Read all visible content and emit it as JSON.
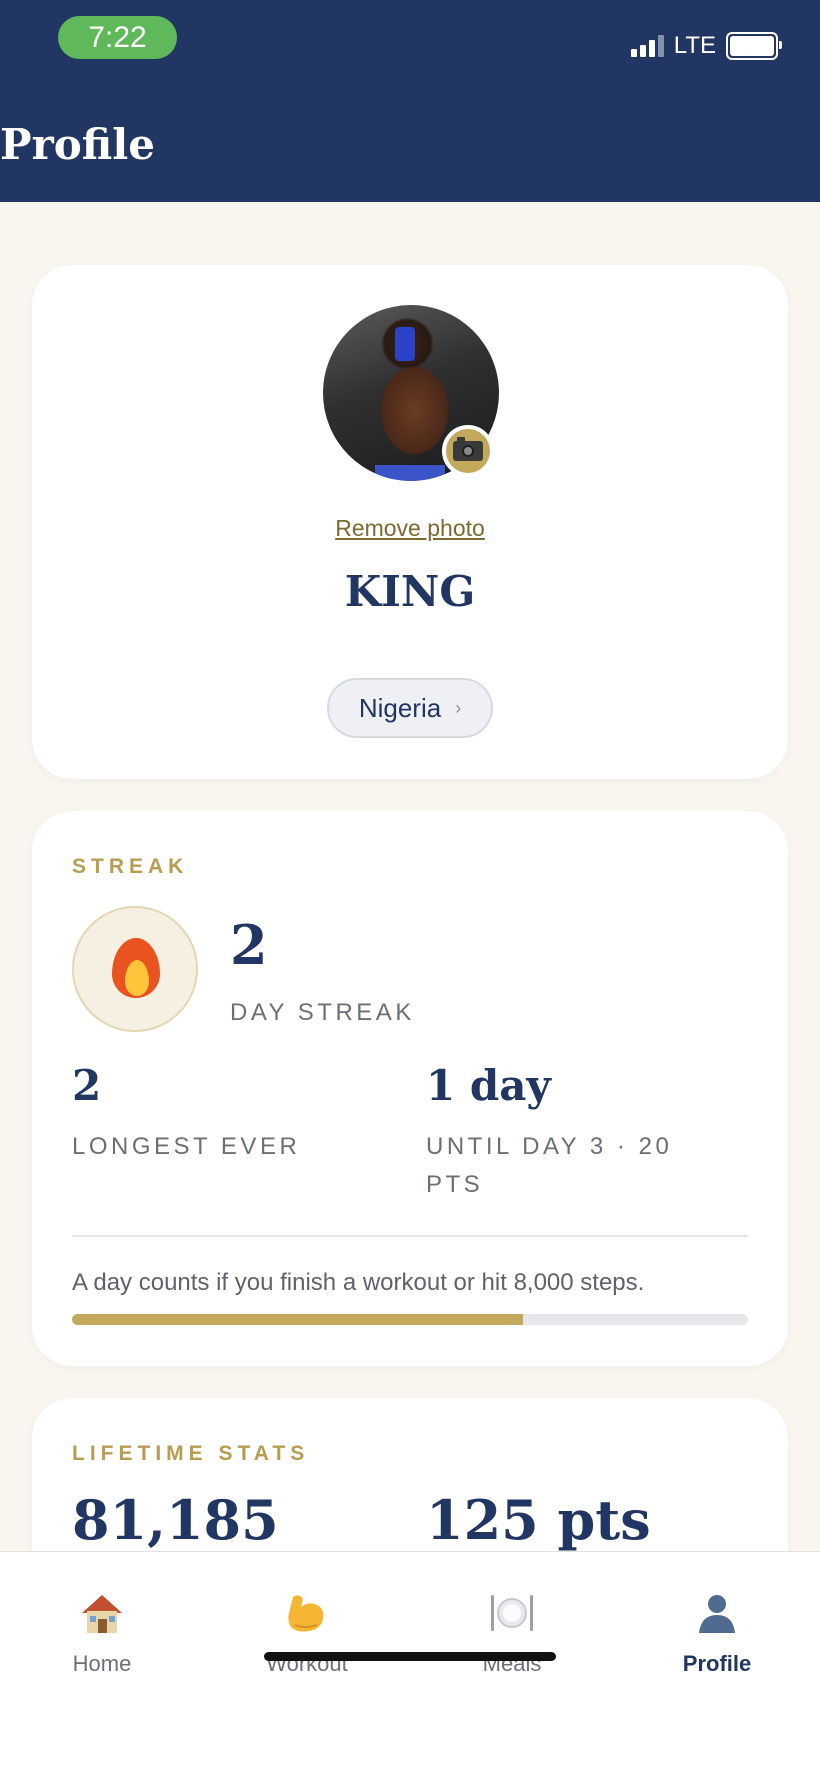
{
  "status_bar": {
    "time": "7:22",
    "network": "LTE"
  },
  "header": {
    "title": "Profile"
  },
  "profile": {
    "remove_photo_label": "Remove photo",
    "name": "KING",
    "country": "Nigeria"
  },
  "streak": {
    "section_label": "STREAK",
    "current_value": "2",
    "current_label": "DAY STREAK",
    "longest_value": "2",
    "longest_label": "LONGEST EVER",
    "next_value": "1 day",
    "next_label_line1": "UNTIL DAY 3 · 20",
    "next_label_line2": "PTS",
    "note": "A day counts if you finish a workout or hit 8,000 steps.",
    "progress_fraction": 0.667
  },
  "lifetime": {
    "section_label": "LIFETIME STATS",
    "stat1_value": "81,185",
    "stat2_value": "125 pts"
  },
  "tabs": [
    {
      "label": "Home",
      "icon": "house-icon",
      "active": false
    },
    {
      "label": "Workout",
      "icon": "flexed-biceps-icon",
      "active": false
    },
    {
      "label": "Meals",
      "icon": "plate-cutlery-icon",
      "active": false
    },
    {
      "label": "Profile",
      "icon": "person-silhouette-icon",
      "active": true
    }
  ],
  "colors": {
    "navy": "#223663",
    "gold": "#b89c4f",
    "background": "#f8f6ef",
    "time_pill": "#5fb95a"
  }
}
